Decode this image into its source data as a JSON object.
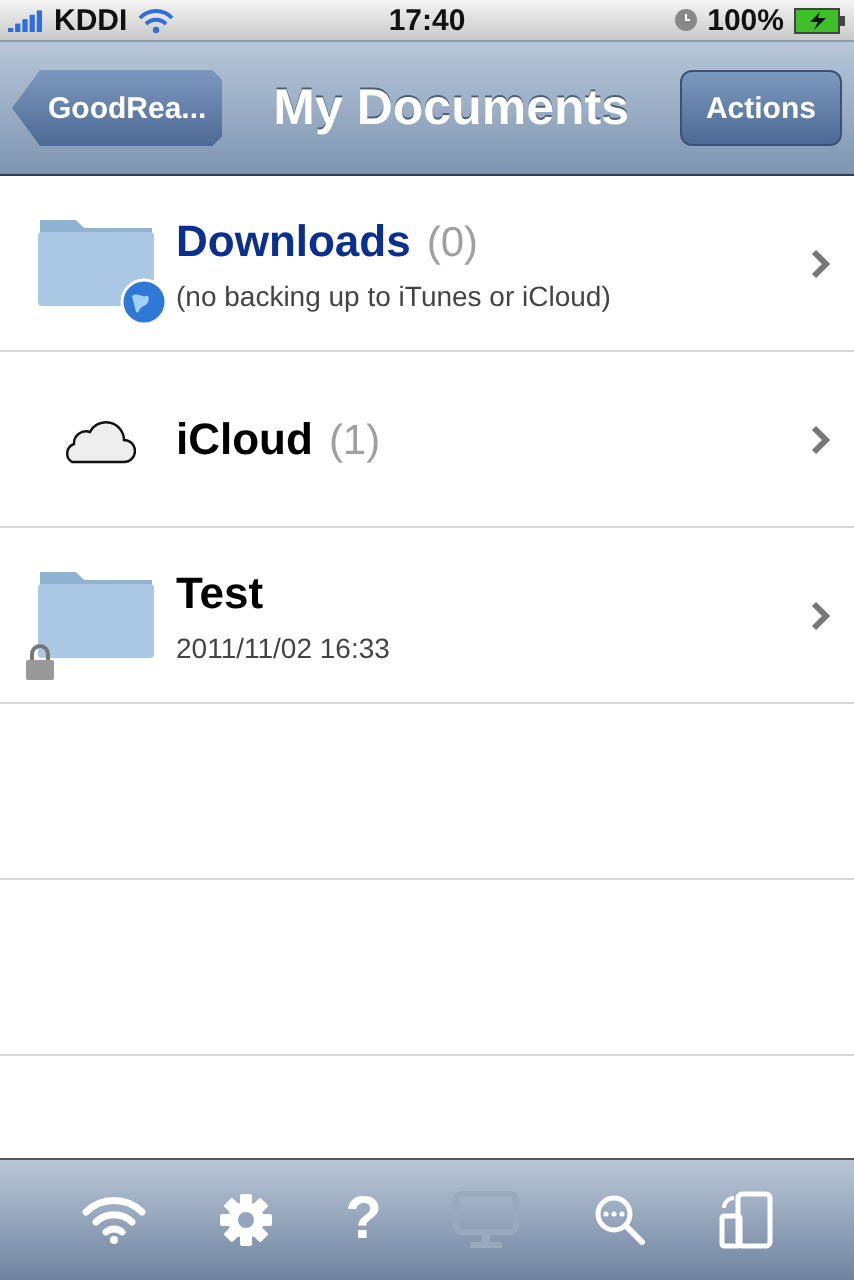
{
  "status_bar": {
    "carrier": "KDDI",
    "time": "17:40",
    "battery": "100%"
  },
  "nav_bar": {
    "back": "GoodRea...",
    "title": "My Documents",
    "action": "Actions"
  },
  "rows": [
    {
      "kind": "folder-globe",
      "title": "Downloads",
      "color": "#0b2f8f",
      "count": "(0)",
      "subtitle": "(no backing up to iTunes or iCloud)"
    },
    {
      "kind": "cloud",
      "title": "iCloud",
      "color": "#000000",
      "count": "(1)"
    },
    {
      "kind": "folder-lock",
      "title": "Test",
      "color": "#000000",
      "subtitle": "2011/11/02 16:33"
    }
  ],
  "toolbar": [
    {
      "kind": "wifi",
      "disabled": false
    },
    {
      "kind": "gear",
      "disabled": false
    },
    {
      "kind": "help",
      "glyph": "?",
      "disabled": false
    },
    {
      "kind": "monitor",
      "disabled": true
    },
    {
      "kind": "search",
      "disabled": false
    },
    {
      "kind": "devices",
      "disabled": false
    }
  ]
}
